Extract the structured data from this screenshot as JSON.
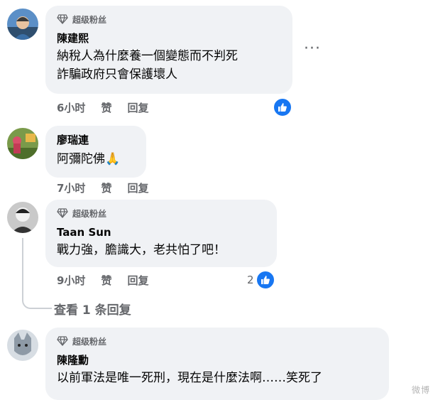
{
  "badge_label": "超级粉丝",
  "comments": [
    {
      "author": "陳建熙",
      "lines": [
        "納稅人為什麼養一個變態而不判死",
        "詐騙政府只會保護壞人"
      ],
      "time": "6小时",
      "like_label": "赞",
      "reply_label": "回复",
      "has_badge": true
    },
    {
      "author": "廖瑞連",
      "lines": [
        "阿彌陀佛🙏"
      ],
      "time": "7小时",
      "like_label": "赞",
      "reply_label": "回复",
      "has_badge": false
    },
    {
      "author": "Taan Sun",
      "lines": [
        "戰力強，膽識大，老共怕了吧！"
      ],
      "time": "9小时",
      "like_label": "赞",
      "reply_label": "回复",
      "reaction_count": "2",
      "has_badge": true
    },
    {
      "author": "陳隆勳",
      "lines": [
        "以前軍法是唯一死刑，現在是什麼法啊……笑死了"
      ],
      "has_badge": true
    }
  ],
  "view_replies": "查看 1 条回复",
  "watermark": "微博"
}
